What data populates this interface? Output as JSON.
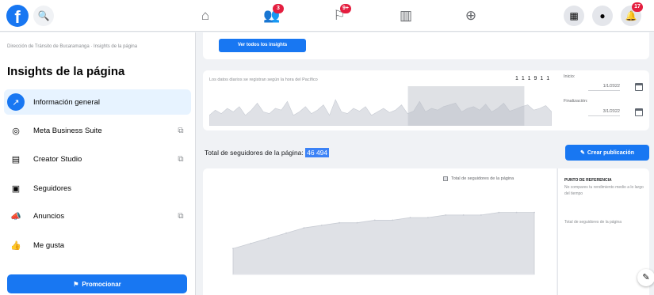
{
  "topbar": {
    "logo": "f",
    "search_icon": "🔍",
    "nav": [
      {
        "name": "home-icon",
        "glyph": "⌂",
        "badge": ""
      },
      {
        "name": "friends-icon",
        "glyph": "👥",
        "badge": "3"
      },
      {
        "name": "pages-flag-icon",
        "glyph": "⚐",
        "badge": "9+"
      },
      {
        "name": "marketplace-icon",
        "glyph": "▥",
        "badge": ""
      },
      {
        "name": "groups-icon",
        "glyph": "⊕",
        "badge": ""
      }
    ],
    "right": [
      {
        "name": "menu-grid-icon",
        "glyph": "▦",
        "badge": ""
      },
      {
        "name": "messenger-icon",
        "glyph": "●",
        "badge": ""
      },
      {
        "name": "notifications-icon",
        "glyph": "🔔",
        "badge": "17"
      }
    ]
  },
  "sidebar": {
    "breadcrumb": "Dirección de Tránsito de Bucaramanga · Insights de la página",
    "title": "Insights de la página",
    "items": [
      {
        "label": "Información general",
        "icon": "↗",
        "external": false,
        "active": true
      },
      {
        "label": "Meta Business Suite",
        "icon": "◎",
        "external": true,
        "active": false
      },
      {
        "label": "Creator Studio",
        "icon": "▤",
        "external": true,
        "active": false
      },
      {
        "label": "Seguidores",
        "icon": "▣",
        "external": false,
        "active": false
      },
      {
        "label": "Anuncios",
        "icon": "📣",
        "external": true,
        "active": false
      },
      {
        "label": "Me gusta",
        "icon": "👍",
        "external": false,
        "active": false
      }
    ],
    "external_icon": "⧉",
    "promote_label": "Promocionar",
    "promote_icon": "⚑"
  },
  "main": {
    "insights_button": "Ver todos los insights",
    "range": {
      "note": "Los datos diarios se registran según la hora del Pacífico",
      "date_range": "1 1 1 9 1 1",
      "start_label": "Inicio:",
      "start_value": "1/1/2022",
      "end_label": "Finalización:",
      "end_value": "3/1/2022"
    },
    "followers": {
      "title": "Total de seguidores de la página:",
      "count": "46 494",
      "create_post": "Crear publicación",
      "create_icon": "✎"
    },
    "chart": {
      "legend": "Total de seguidores de la página"
    },
    "reference": {
      "title": "PUNTO DE REFERENCIA",
      "description": "No compares tu rendimiento medio a lo largo del tiempo",
      "item": "Total de seguidores de la página"
    }
  },
  "colors": {
    "brand": "#1877f2",
    "badge": "#e41e3f",
    "chart_fill": "#dfe1e6",
    "chart_stroke": "#c7cbd3",
    "chart_selected": "#b9bcc6"
  },
  "chart_data": {
    "type": "area",
    "series": [
      {
        "values": [
          46480,
          46482,
          46484,
          46486,
          46488,
          46489,
          46490,
          46490,
          46491,
          46491,
          46492,
          46492,
          46493,
          46493,
          46493,
          46494,
          46494,
          46494
        ]
      }
    ],
    "ylim": [
      46470,
      46500
    ],
    "grid": false,
    "legend": "top-right"
  },
  "mini_chart_data": {
    "type": "area",
    "values": [
      0.3,
      0.45,
      0.35,
      0.5,
      0.4,
      0.55,
      0.3,
      0.45,
      0.65,
      0.4,
      0.35,
      0.5,
      0.45,
      0.7,
      0.3,
      0.4,
      0.55,
      0.35,
      0.45,
      0.6,
      0.3,
      0.75,
      0.4,
      0.35,
      0.5,
      0.42,
      0.55,
      0.3,
      0.4,
      0.5,
      0.38,
      0.45,
      0.6,
      0.35,
      0.42,
      0.7,
      0.4,
      0.5,
      0.45,
      0.55,
      0.6,
      0.65,
      0.4,
      0.5,
      0.55,
      0.45,
      0.62,
      0.4,
      0.5,
      0.65,
      0.42,
      0.48,
      0.55,
      0.6,
      0.45,
      0.5,
      0.58,
      0.4
    ],
    "selected_from": 0.58,
    "selected_to": 0.92
  }
}
